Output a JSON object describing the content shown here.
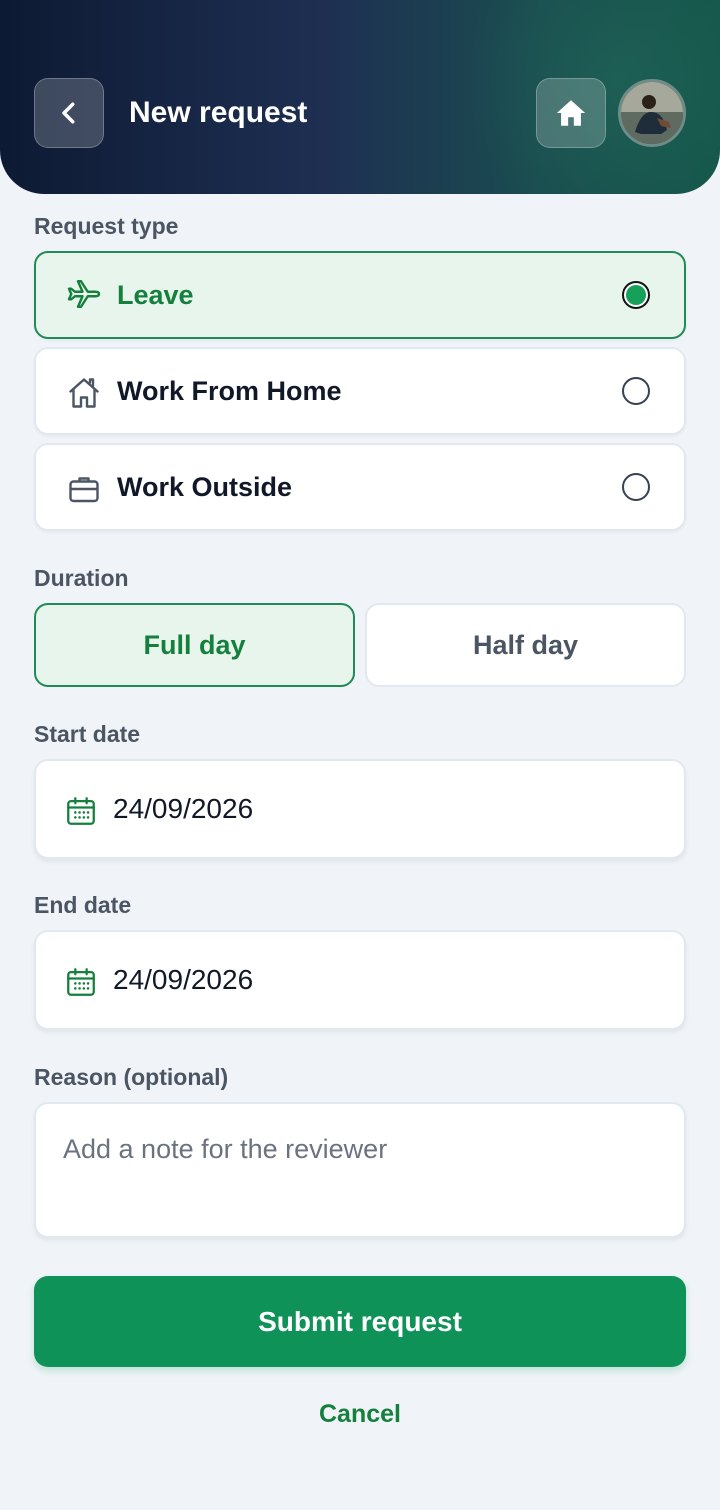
{
  "header": {
    "title": "New request",
    "back_icon": "chevron-left-icon",
    "home_icon": "home-icon",
    "avatar": "user-avatar"
  },
  "request_type": {
    "label": "Request type",
    "options": [
      {
        "label": "Leave",
        "icon": "airplane-icon",
        "selected": true
      },
      {
        "label": "Work From Home",
        "icon": "house-icon",
        "selected": false
      },
      {
        "label": "Work Outside",
        "icon": "briefcase-icon",
        "selected": false
      }
    ]
  },
  "duration": {
    "label": "Duration",
    "options": [
      {
        "label": "Full day",
        "selected": true
      },
      {
        "label": "Half day",
        "selected": false
      }
    ]
  },
  "start_date": {
    "label": "Start date",
    "value": "24/09/2026",
    "icon": "calendar-icon"
  },
  "end_date": {
    "label": "End date",
    "value": "24/09/2026",
    "icon": "calendar-icon"
  },
  "reason": {
    "label": "Reason (optional)",
    "placeholder": "Add a note for the reviewer",
    "value": ""
  },
  "actions": {
    "submit_label": "Submit request",
    "cancel_label": "Cancel"
  },
  "colors": {
    "accent": "#0e9257",
    "accent_text": "#15803d",
    "selected_bg": "#e8f5ec",
    "header_dark": "#0d1a33",
    "header_teal": "#15564a",
    "background": "#f0f4f8"
  }
}
